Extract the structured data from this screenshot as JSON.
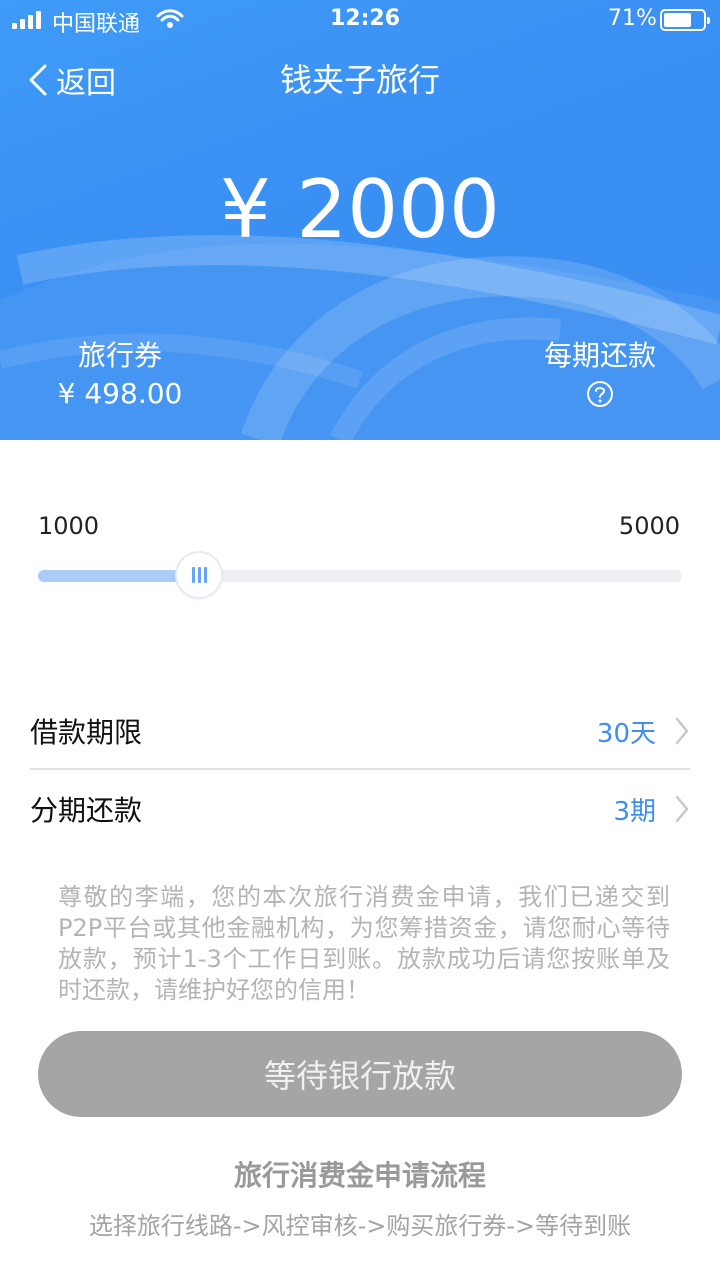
{
  "status_bar": {
    "carrier": "中国联通",
    "time": "12:26",
    "battery": "71%",
    "battery_level": 0.71
  },
  "nav": {
    "back_label": "返回",
    "title": "钱夹子旅行"
  },
  "hero": {
    "amount": "¥ 2000",
    "voucher_label": "旅行券",
    "voucher_value": "¥ 498.00",
    "per_period_label": "每期还款"
  },
  "slider": {
    "min_label": "1000",
    "max_label": "5000",
    "min": 1000,
    "max": 5000,
    "value": 2000
  },
  "loan_term": {
    "label": "借款期限",
    "value": "30天"
  },
  "installments": {
    "label": "分期还款",
    "value": "3期"
  },
  "notice": "尊敬的李端，您的本次旅行消费金申请，我们已递交到P2P平台或其他金融机构，为您筹措资金，请您耐心等待放款，预计1-3个工作日到账。放款成功后请您按账单及时还款，请维护好您的信用！",
  "action_button": "等待银行放款",
  "process": {
    "title": "旅行消费金申请流程",
    "steps": "选择旅行线路->风控审核->购买旅行券->等待到账"
  },
  "colors": {
    "brand_blue": "#3b8ff2",
    "accent_value": "#3f8ef2",
    "button_disabled": "#a5a5a5"
  }
}
